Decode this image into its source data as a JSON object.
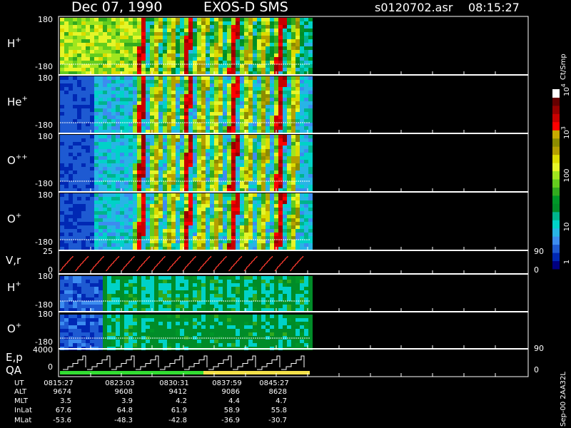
{
  "header": {
    "date": "Dec 07, 1990",
    "instrument": "EXOS-D SMS",
    "file": "s0120702.asr",
    "time": "08:15:27"
  },
  "colorbar": {
    "unit": "Ct/Smp",
    "labels": [
      "1",
      "10",
      "100",
      "10",
      "10"
    ],
    "label_powers": [
      "",
      "",
      "",
      "3",
      "4"
    ],
    "colors": [
      "#000080",
      "#0028b4",
      "#1e5ad2",
      "#3c8cf0",
      "#28b4e6",
      "#00d2c8",
      "#00b48c",
      "#008c28",
      "#009628",
      "#32aa1e",
      "#64cd1e",
      "#a0e61e",
      "#e6f528",
      "#dcdc00",
      "#b4a000",
      "#8c8c00",
      "#c8aa00",
      "#ff0000",
      "#c80000",
      "#960000",
      "#640000",
      "#ffffff"
    ]
  },
  "panels": [
    {
      "species": "H",
      "charge": "+",
      "ytop": "180",
      "ybot": "-180"
    },
    {
      "species": "He",
      "charge": "+",
      "ytop": "180",
      "ybot": "-180"
    },
    {
      "species": "O",
      "charge": "++",
      "ytop": "180",
      "ybot": "-180"
    },
    {
      "species": "O",
      "charge": "+",
      "ytop": "180",
      "ybot": "-180"
    }
  ],
  "vr_panel": {
    "label": "V,r",
    "ytop": "25",
    "ybot": "0",
    "right_top": "90",
    "right_bot": "0"
  },
  "lower_panels": [
    {
      "species": "H",
      "charge": "+",
      "ytop": "180",
      "ybot": "-180"
    },
    {
      "species": "O",
      "charge": "+",
      "ytop": "180",
      "ybot": "-180",
      "right_bot": "90"
    }
  ],
  "ep_panel": {
    "label1": "E,p",
    "label2": "QA",
    "ytop": "4000",
    "ybot": "0",
    "right": "0"
  },
  "footer": {
    "row_labels": [
      "UT",
      "ALT",
      "MLT",
      "InLat",
      "MLat"
    ],
    "columns": [
      [
        "0815:27",
        "9674",
        "3.5",
        "67.6",
        "-53.6"
      ],
      [
        "0823:03",
        "9608",
        "3.9",
        "64.8",
        "-48.3"
      ],
      [
        "0830:31",
        "9412",
        "4.2",
        "61.9",
        "-42.8"
      ],
      [
        "0837:59",
        "9086",
        "4.4",
        "58.9",
        "-36.9"
      ],
      [
        "0845:27",
        "8628",
        "4.7",
        "55.8",
        "-30.7"
      ]
    ],
    "side_text": "Sep-00 2AA32L"
  },
  "chart_data": {
    "type": "heatmap",
    "title": "Dec 07, 1990 EXOS-D SMS",
    "x_ticks": [
      "0815:27",
      "0823:03",
      "0830:31",
      "0837:59",
      "0845:27"
    ],
    "panels": [
      "H+",
      "He+",
      "O++",
      "O+",
      "V,r",
      "H+",
      "O+",
      "E,p QA"
    ],
    "y_range_angle": [
      -180,
      180
    ],
    "colorbar_range": [
      1,
      10000
    ],
    "colorbar_scale": "log",
    "data_coverage_end": "0845:27",
    "qa_segments": [
      {
        "from": "0815:27",
        "to": "0837:59",
        "color": "#33dd33"
      },
      {
        "from": "0837:59",
        "to": "0845:27",
        "color": "#f5e14a"
      }
    ]
  }
}
